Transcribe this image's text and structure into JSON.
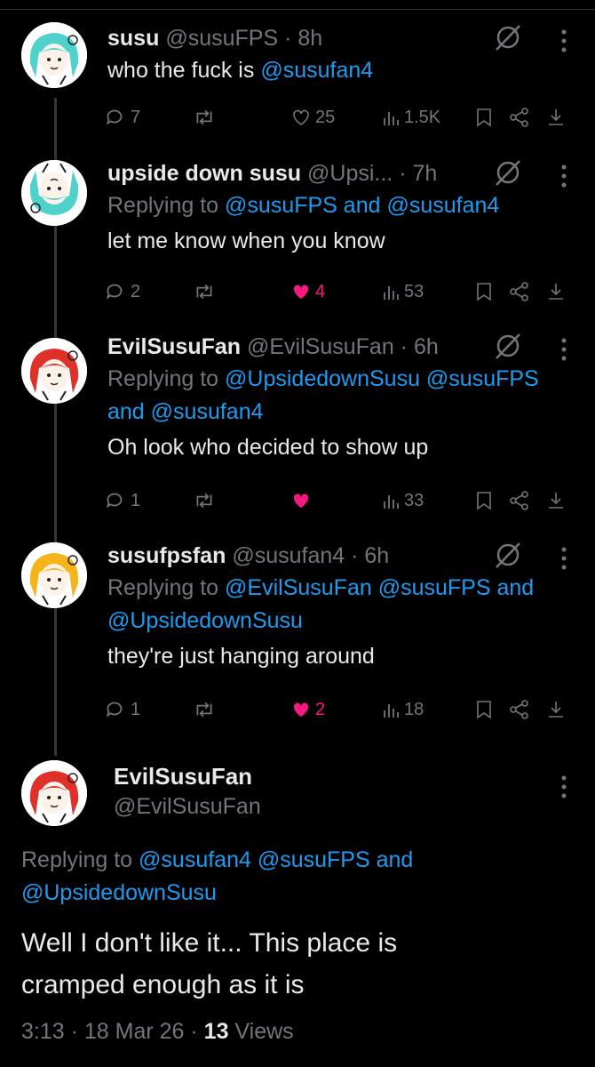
{
  "colors": {
    "accent": "#1d9bf0",
    "like": "#f91880",
    "muted": "#71767b",
    "text": "#e7e9ea"
  },
  "tweets": [
    {
      "name": "susu",
      "handle": "@susuFPS",
      "sep": " · ",
      "time": "8h",
      "replying": null,
      "text_prefix": "who the fuck is ",
      "text_link": "@susufan4",
      "replies": "7",
      "likes": "25",
      "liked": false,
      "views": "1.5K",
      "avatar": "teal"
    },
    {
      "name": "upside down susu",
      "handle": "@Upsi...",
      "sep": " · ",
      "time": "7h",
      "replying": {
        "prefix": "Replying to ",
        "link": "@susuFPS and @susufan4"
      },
      "text_prefix": "let me know when you know",
      "text_link": "",
      "replies": "2",
      "likes": "4",
      "liked": true,
      "views": "53",
      "avatar": "teal-flipped"
    },
    {
      "name": "EvilSusuFan",
      "handle": "@EvilSusuFan",
      "sep": " · ",
      "time": "6h",
      "replying": {
        "prefix": "Replying to ",
        "link": "@UpsidedownSusu @susuFPS and @susufan4"
      },
      "text_prefix": "Oh look who decided to show up",
      "text_link": "",
      "replies": "1",
      "likes": "",
      "liked": true,
      "views": "33",
      "avatar": "red"
    },
    {
      "name": "susufpsfan",
      "handle": "@susufan4",
      "sep": " · ",
      "time": "6h",
      "replying": {
        "prefix": "Replying to ",
        "link": "@EvilSusuFan @susuFPS and @UpsidedownSusu"
      },
      "text_prefix": "they're just hanging around",
      "text_link": "",
      "replies": "1",
      "likes": "2",
      "liked": true,
      "views": "18",
      "avatar": "yellow"
    }
  ],
  "main": {
    "name": "EvilSusuFan",
    "handle": "@EvilSusuFan",
    "replying_prefix": "Replying to ",
    "replying_link1": "@susufan4 @susuFPS and",
    "replying_link2": "@UpsidedownSusu",
    "text_line1": "Well I don't like it... This place is",
    "text_line2": "cramped enough as it is",
    "time": "3:13",
    "sep1": " · ",
    "date": "18 Mar 26",
    "sep2": " · ",
    "views_count": "13",
    "views_label": " Views",
    "avatar": "red"
  }
}
